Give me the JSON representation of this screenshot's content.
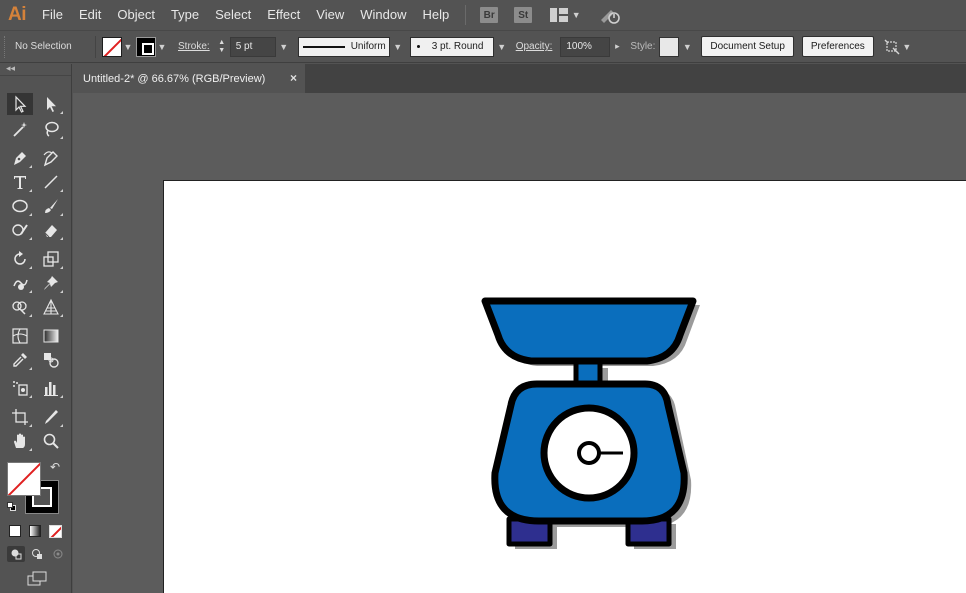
{
  "app": {
    "logo_text": "Ai",
    "menus": [
      "File",
      "Edit",
      "Object",
      "Type",
      "Select",
      "Effect",
      "View",
      "Window",
      "Help"
    ],
    "bridge_badge": "Br",
    "stock_badge": "St"
  },
  "control_bar": {
    "selection_status": "No Selection",
    "stroke_label": "Stroke:",
    "stroke_weight": "5 pt",
    "profile_label": "Uniform",
    "brush_label": "3 pt. Round",
    "opacity_label": "Opacity:",
    "opacity_value": "100%",
    "style_label": "Style:",
    "document_setup_label": "Document Setup",
    "preferences_label": "Preferences"
  },
  "document": {
    "tab_title": "Untitled-2* @ 66.67% (RGB/Preview)",
    "close_glyph": "×"
  },
  "toolbox": {
    "collapse_glyph": "◂◂",
    "swap_glyph": "↶"
  },
  "colors": {
    "ui_bg": "#535353",
    "pasteboard": "#5c5c5c",
    "artboard": "#ffffff",
    "scale_blue": "#0a6ebd",
    "scale_feet": "#2e2f8f",
    "outline": "#000000",
    "shadow": "#7a7a7a",
    "none_swatch_red": "#e02020"
  }
}
